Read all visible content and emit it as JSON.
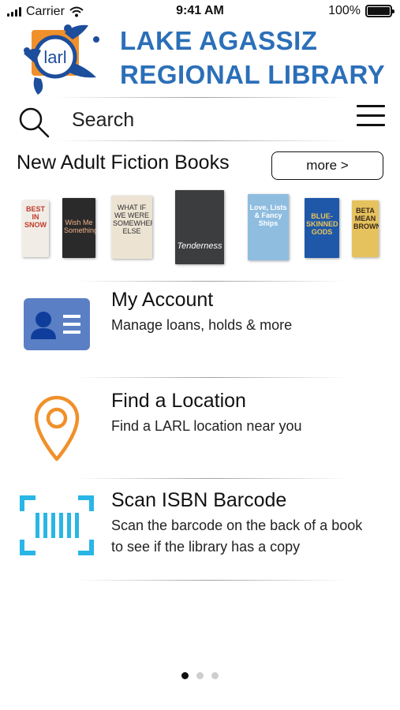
{
  "status_bar": {
    "carrier": "Carrier",
    "time": "9:41 AM",
    "battery": "100%",
    "battery_level": 1.0
  },
  "header": {
    "logo_text": "larl",
    "brand_line1": "LAKE AGASSIZ",
    "brand_line2": "REGIONAL LIBRARY",
    "brand_color": "#2b6fb8"
  },
  "search": {
    "label": "Search",
    "icon": "search-icon",
    "menu_icon": "hamburger-menu-icon"
  },
  "new_books": {
    "title": "New Adult Fiction Books",
    "more_label": "more >",
    "books": [
      {
        "cover_text": "BEST IN SNOW",
        "color": "#f1ede6"
      },
      {
        "cover_text": "Wish Me Something",
        "color": "#2a2a2a"
      },
      {
        "cover_text": "WHAT IF WE WERE SOMEWHERE ELSE",
        "color": "#ece3d3"
      },
      {
        "cover_text": "Tenderness",
        "color": "#3c3d3f"
      },
      {
        "cover_text": "Love, Lists & Fancy Ships",
        "color": "#8fbde0"
      },
      {
        "cover_text": "BLUE-SKINNED GODS",
        "color": "#1f58a8"
      },
      {
        "cover_text": "BETA MEAN BROWN",
        "color": "#e6c25e"
      }
    ]
  },
  "menu_items": [
    {
      "title": "My Account",
      "description": "Manage loans, holds & more",
      "icon": "account-card-icon",
      "icon_color": "#5a7fc4"
    },
    {
      "title": "Find a Location",
      "description": "Find a LARL location near you",
      "icon": "location-pin-icon",
      "icon_color": "#f0902b"
    },
    {
      "title": "Scan ISBN Barcode",
      "description_line1": "Scan the barcode on the back of a book",
      "description_line2": "to see if the library has a copy",
      "icon": "barcode-scan-icon",
      "icon_color": "#29b6e6"
    }
  ],
  "pagination": {
    "total_pages": 3,
    "active_page": 1
  }
}
